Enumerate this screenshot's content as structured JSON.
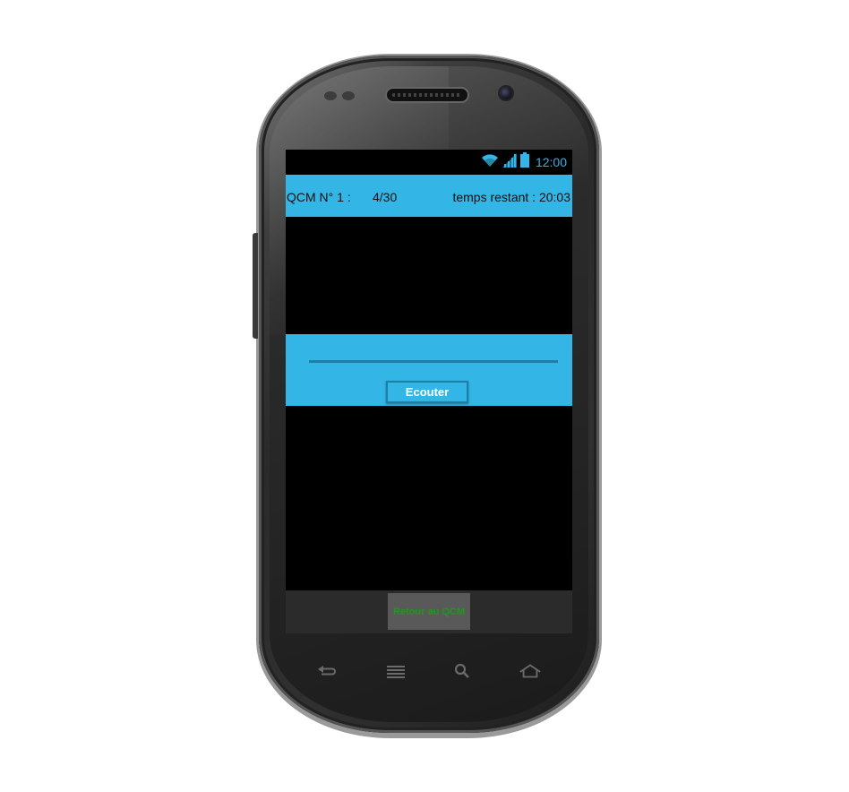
{
  "status_bar": {
    "time": "12:00",
    "icons": [
      "wifi-icon",
      "signal-icon",
      "battery-icon"
    ],
    "accent_color": "#33b5e5"
  },
  "header": {
    "qcm_label": "QCM N° 1 :",
    "progress": "4/30",
    "timer": "temps restant : 20:03",
    "background_color": "#33b5e5"
  },
  "audio_player": {
    "seek_position": 0.0,
    "listen_label": "Ecouter"
  },
  "footer": {
    "return_label": "Retour au QCM",
    "return_label_color": "#1a9b1a"
  },
  "hardware_keys": [
    "back-icon",
    "menu-icon",
    "search-icon",
    "home-icon"
  ]
}
